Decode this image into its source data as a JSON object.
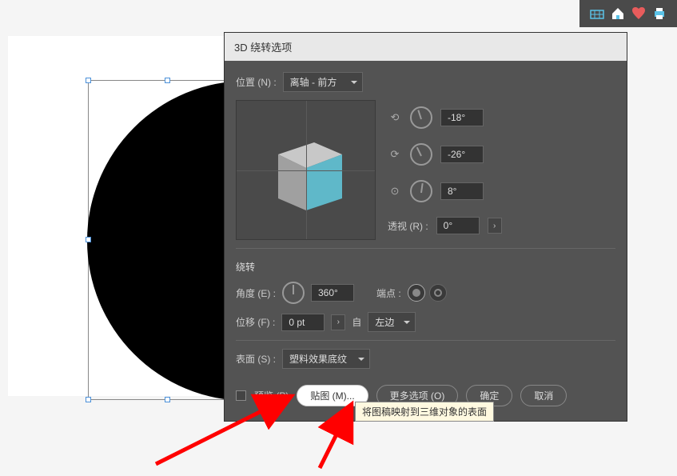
{
  "toolbar": {
    "icons": [
      "grid-icon",
      "home-icon",
      "heart-icon",
      "print-icon"
    ]
  },
  "dialog": {
    "title": "3D 绕转选项",
    "position_label": "位置 (N) :",
    "position_value": "离轴 - 前方",
    "angles": {
      "x": "-18°",
      "y": "-26°",
      "z": "8°"
    },
    "perspective_label": "透视 (R) :",
    "perspective_value": "0°",
    "revolve_title": "绕转",
    "angle_label": "角度 (E) :",
    "angle_value": "360°",
    "cap_label": "端点 :",
    "offset_label": "位移 (F) :",
    "offset_value": "0 pt",
    "from_label": "自",
    "from_value": "左边",
    "surface_label": "表面 (S) :",
    "surface_value": "塑料效果底纹",
    "preview_label": "预览 (P)",
    "map_art_label": "贴图 (M)...",
    "more_options_label": "更多选项 (O)",
    "ok_label": "确定",
    "cancel_label": "取消"
  },
  "tooltip": "将图稿映射到三维对象的表面"
}
